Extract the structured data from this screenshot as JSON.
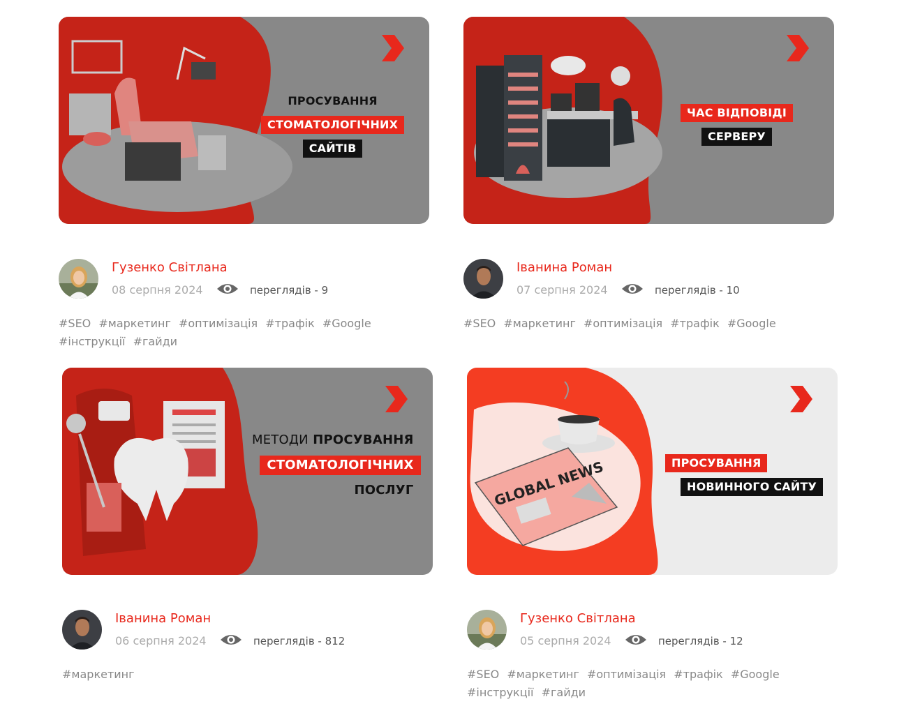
{
  "cards": [
    {
      "title_lines": [
        "ПРОСУВАННЯ",
        "СТОМАТОЛОГІЧНИХ",
        "САЙТІВ"
      ],
      "author": "Гузенко Світлана",
      "date": "08 серпня 2024",
      "views": "переглядів - 9",
      "tags": [
        "#SEO",
        "#маркетинг",
        "#оптимізація",
        "#трафік",
        "#Google",
        "#інструкції",
        "#гайди"
      ]
    },
    {
      "title_lines": [
        "ЧАС ВІДПОВІДІ",
        "СЕРВЕРУ"
      ],
      "author": "Іванина Роман",
      "date": "07 серпня 2024",
      "views": "переглядів - 10",
      "tags": [
        "#SEO",
        "#маркетинг",
        "#оптимізація",
        "#трафік",
        "#Google"
      ]
    },
    {
      "title_lines": [
        "МЕТОДИ",
        "ПРОСУВАННЯ",
        "СТОМАТОЛОГІЧНИХ",
        "ПОСЛУГ"
      ],
      "author": "Іванина Роман",
      "date": "06 серпня 2024",
      "views": "переглядів - 812",
      "tags": [
        "#маркетинг"
      ]
    },
    {
      "title_lines": [
        "ПРОСУВАННЯ",
        "НОВИННОГО САЙТУ"
      ],
      "newspaper_text": "GLOBAL NEWS",
      "author": "Гузенко Світлана",
      "date": "05 серпня 2024",
      "views": "переглядів - 12",
      "tags": [
        "#SEO",
        "#маркетинг",
        "#оптимізація",
        "#трафік",
        "#Google",
        "#інструкції",
        "#гайди"
      ]
    }
  ],
  "colors": {
    "accent": "#e8281c",
    "overlay_gray": "#888888",
    "date": "#aaaaaa",
    "tag": "#888888"
  },
  "icons": {
    "views": "eye-icon",
    "thumb_arrow": "chevron-right-icon"
  }
}
